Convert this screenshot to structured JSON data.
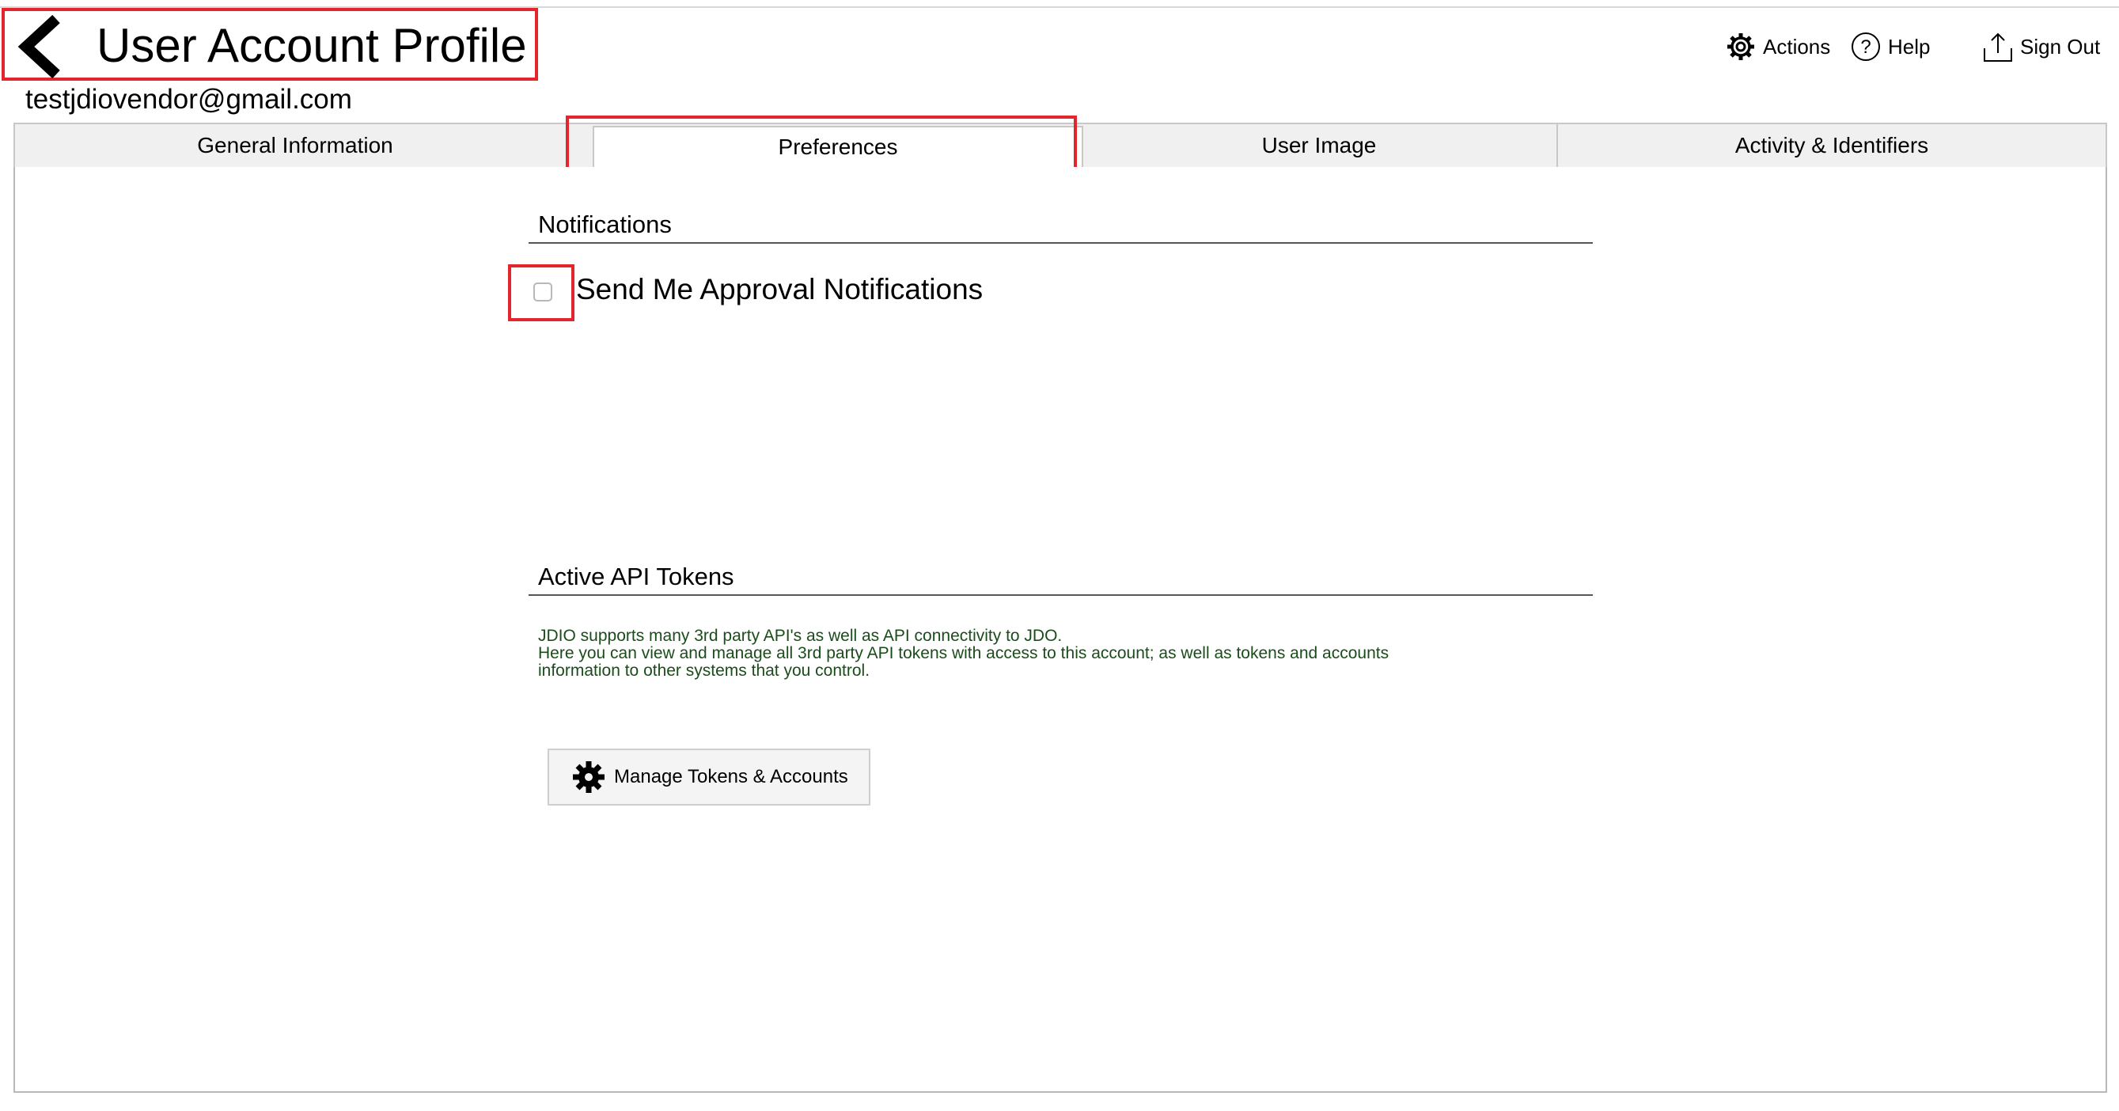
{
  "header": {
    "title": "User Account Profile",
    "email": "testjdiovendor@gmail.com",
    "back_icon": "chevron-left-icon",
    "actions": [
      {
        "label": "Actions",
        "icon": "gear-icon"
      },
      {
        "label": "Help",
        "icon": "help-circle-icon"
      },
      {
        "label": "Sign Out",
        "icon": "upload-icon"
      }
    ]
  },
  "tabs": [
    {
      "label": "General Information",
      "selected": false
    },
    {
      "label": "Preferences",
      "selected": true
    },
    {
      "label": "User Image",
      "selected": false
    },
    {
      "label": "Activity & Identifiers",
      "selected": false
    }
  ],
  "notifications": {
    "heading": "Notifications",
    "checkbox_label": "Send Me Approval Notifications",
    "checked": false
  },
  "api_tokens": {
    "heading": "Active API Tokens",
    "description": [
      "JDIO supports many 3rd party API's as well as API connectivity to JDO.",
      "Here you can view and manage all 3rd party API tokens with access to this account; as well as tokens and accounts",
      "information to other systems that you control."
    ],
    "button_label": "Manage Tokens & Accounts",
    "button_icon": "gear-icon"
  },
  "colors": {
    "highlight": "#e3262b",
    "description_text": "#1a4d1a",
    "tab_bar": "#f0f0f0"
  }
}
